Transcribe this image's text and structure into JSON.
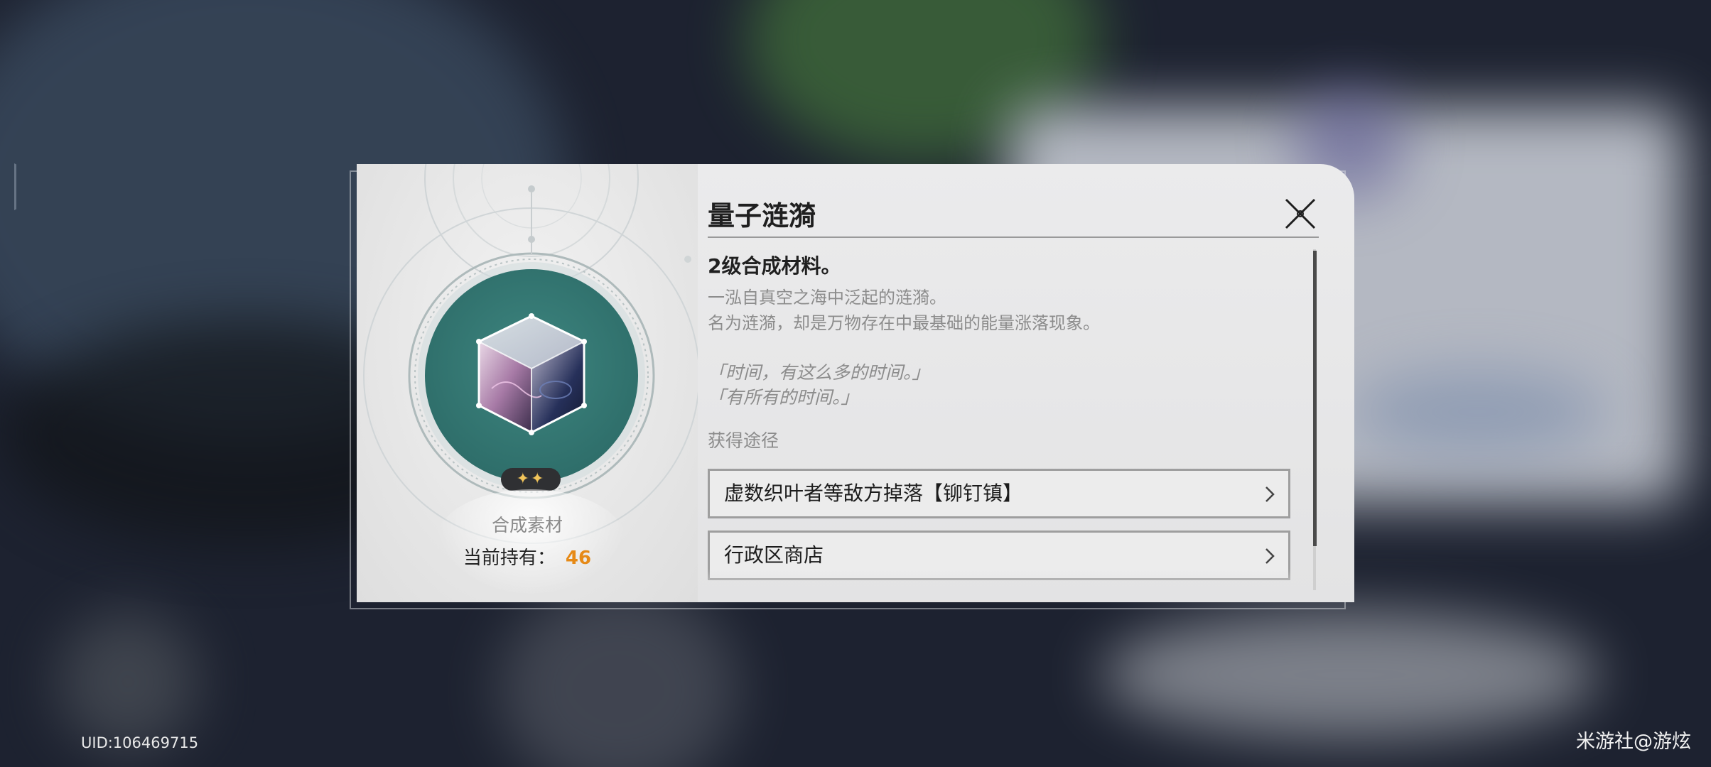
{
  "item": {
    "name": "量子涟漪",
    "subtitle": "2级合成材料。",
    "description": [
      "一泓自真空之海中泛起的涟漪。",
      "名为涟漪，却是万物存在中最基础的能量涨落现象。"
    ],
    "quote": [
      "「时间，有这么多的时间。」",
      "「有所有的时间。」"
    ],
    "rarity_stars": "✦✦",
    "type": "合成素材",
    "owned_label": "当前持有：",
    "owned_count": "46",
    "icon": "quantum-cube-icon"
  },
  "sources": {
    "heading": "获得途径",
    "items": [
      {
        "label": "虚数织叶者等敌方掉落【铆钉镇】"
      },
      {
        "label": "行政区商店"
      }
    ]
  },
  "footer": {
    "uid": "UID:106469715",
    "watermark": "米游社@游炫"
  },
  "colors": {
    "accent_count": "#e68a17",
    "item_circle": "#2f6f6b",
    "rarity_star": "#f1c45a"
  }
}
